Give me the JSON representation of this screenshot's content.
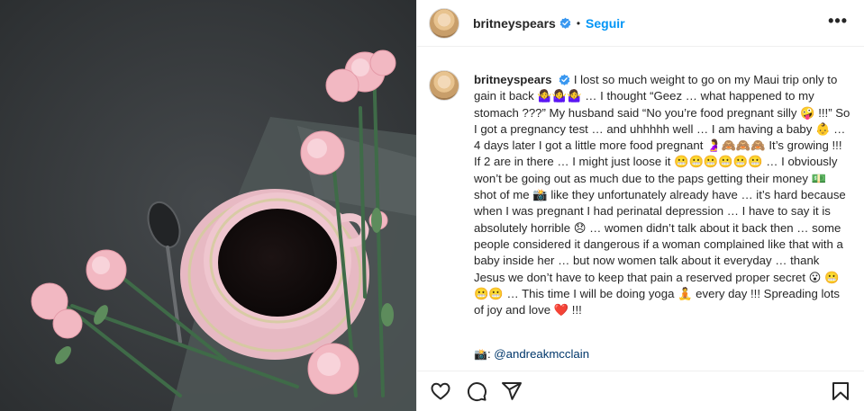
{
  "post": {
    "username": "britneyspears",
    "dot": "•",
    "follow_label": "Seguir",
    "more_label": "•••"
  },
  "caption": {
    "username": "britneyspears",
    "text": "I lost so much weight to go on my Maui trip only to gain it back 🤷‍♀️🤷‍♀️🤷‍♀️ … I thought “Geez … what happened to my stomach ???” My husband said “No you’re food pregnant silly 🤪 !!!” So I got a pregnancy test … and uhhhhh well … I am having a baby 👶 … 4 days later I got a little more food pregnant 🤰🙈🙈🙈 It’s growing !!! If 2 are in there … I might just loose it 😬😬😬😬😬😬 … I obviously won’t be going out as much due to the paps getting their money 💵 shot of me 📸 like they unfortunately already have … it’s hard because when I was pregnant I had perinatal depression … I have to say it is absolutely horrible 😞 … women didn’t talk about it back then … some people considered it dangerous if a woman complained like that with a baby inside her … but now women talk about it everyday … thank Jesus we don’t have to keep that pain a reserved proper secret 😮 😬😬😬 … This time I will be doing yoga 🧘 every day !!! Spreading lots of joy and love ❤️ !!!",
    "credit_icon": "📸",
    "credit_sep": ": ",
    "credit_handle": "@andreakmcclain"
  },
  "icons": {
    "like": "heart-icon",
    "comment": "comment-icon",
    "share": "share-icon",
    "save": "bookmark-icon",
    "verified": "verified-badge-icon"
  },
  "colors": {
    "accent": "#0095f6",
    "verified": "#3897f0",
    "photo_bg": "#3a3d40",
    "cup_pink": "#e8b4bf"
  }
}
